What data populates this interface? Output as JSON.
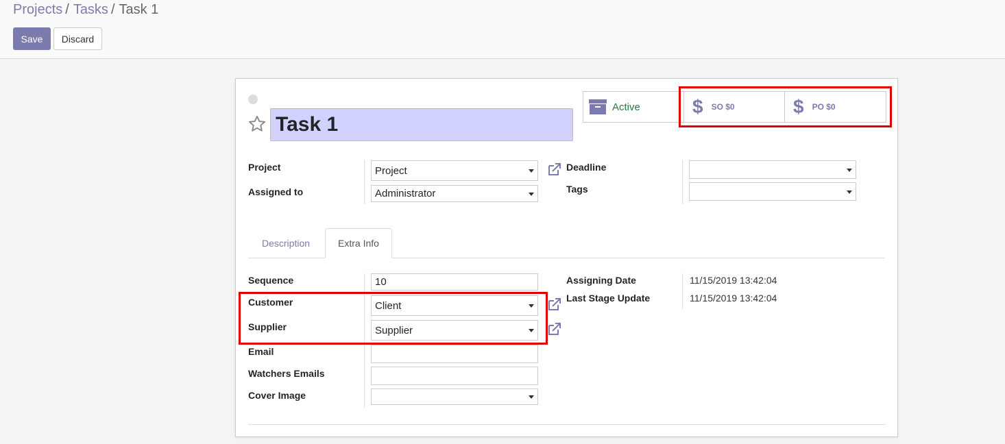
{
  "breadcrumb": {
    "items": [
      "Projects",
      "Tasks"
    ],
    "separator": "/",
    "current": "Task 1"
  },
  "toolbar": {
    "save_label": "Save",
    "discard_label": "Discard"
  },
  "smart_buttons": {
    "active_label": "Active",
    "so_label": "SO $0",
    "po_label": "PO $0",
    "dollar_glyph": "$"
  },
  "title": "Task 1",
  "fields": {
    "project": {
      "label": "Project",
      "value": "Project"
    },
    "assigned_to": {
      "label": "Assigned to",
      "value": "Administrator"
    },
    "deadline": {
      "label": "Deadline",
      "value": ""
    },
    "tags": {
      "label": "Tags",
      "value": ""
    }
  },
  "tabs": [
    {
      "label": "Description",
      "active": false
    },
    {
      "label": "Extra Info",
      "active": true
    }
  ],
  "extra_info": {
    "sequence": {
      "label": "Sequence",
      "value": "10"
    },
    "customer": {
      "label": "Customer",
      "value": "Client"
    },
    "supplier": {
      "label": "Supplier",
      "value": "Supplier"
    },
    "email": {
      "label": "Email",
      "value": ""
    },
    "watchers_emails": {
      "label": "Watchers Emails",
      "value": ""
    },
    "cover_image": {
      "label": "Cover Image",
      "value": ""
    },
    "assigning_date": {
      "label": "Assigning Date",
      "value": "11/15/2019 13:42:04"
    },
    "last_stage_update": {
      "label": "Last Stage Update",
      "value": "11/15/2019 13:42:04"
    }
  },
  "colors": {
    "brand": "#7c7bad",
    "active_text": "#28793f",
    "title_bg": "#d2d2ff",
    "highlight": "#e00000"
  },
  "icons": {
    "archive": "archive-icon",
    "dollar": "dollar-icon",
    "star": "star-icon",
    "external_link": "external-link-icon",
    "dropdown": "caret-down-icon"
  }
}
